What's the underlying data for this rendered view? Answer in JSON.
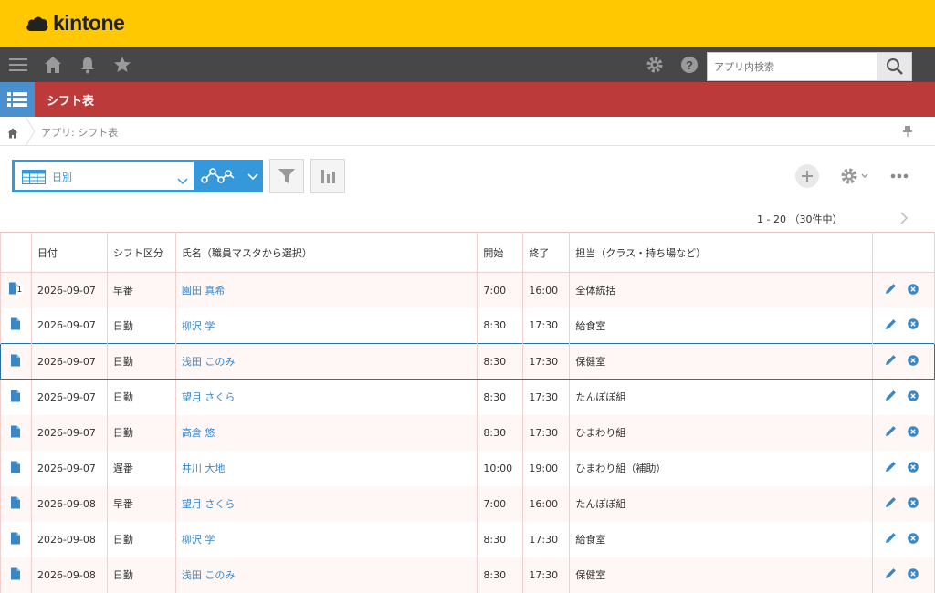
{
  "brand": {
    "name": "kintone"
  },
  "search": {
    "placeholder": "アプリ内検索"
  },
  "app": {
    "title": "シフト表"
  },
  "breadcrumb": {
    "text": "アプリ: シフト表"
  },
  "view": {
    "selected": "日別"
  },
  "pager": {
    "text": "1 - 20 （30件中）"
  },
  "columns": [
    "日付",
    "シフト区分",
    "氏名（職員マスタから選択）",
    "開始",
    "終了",
    "担当（クラス・持ち場など）"
  ],
  "rows": [
    {
      "date": "2026-09-07",
      "shift": "早番",
      "name": "園田 真希",
      "start": "7:00",
      "end": "16:00",
      "duty": "全体統括",
      "badge": "1"
    },
    {
      "date": "2026-09-07",
      "shift": "日勤",
      "name": "柳沢 学",
      "start": "8:30",
      "end": "17:30",
      "duty": "給食室"
    },
    {
      "date": "2026-09-07",
      "shift": "日勤",
      "name": "浅田 このみ",
      "start": "8:30",
      "end": "17:30",
      "duty": "保健室",
      "selected": true
    },
    {
      "date": "2026-09-07",
      "shift": "日勤",
      "name": "望月 さくら",
      "start": "8:30",
      "end": "17:30",
      "duty": "たんぽぽ組"
    },
    {
      "date": "2026-09-07",
      "shift": "日勤",
      "name": "高倉 悠",
      "start": "8:30",
      "end": "17:30",
      "duty": "ひまわり組"
    },
    {
      "date": "2026-09-07",
      "shift": "遅番",
      "name": "井川 大地",
      "start": "10:00",
      "end": "19:00",
      "duty": "ひまわり組（補助）"
    },
    {
      "date": "2026-09-08",
      "shift": "早番",
      "name": "望月 さくら",
      "start": "7:00",
      "end": "16:00",
      "duty": "たんぽぽ組"
    },
    {
      "date": "2026-09-08",
      "shift": "日勤",
      "name": "柳沢 学",
      "start": "8:30",
      "end": "17:30",
      "duty": "給食室"
    },
    {
      "date": "2026-09-08",
      "shift": "日勤",
      "name": "浅田 このみ",
      "start": "8:30",
      "end": "17:30",
      "duty": "保健室"
    }
  ],
  "colors": {
    "brand": "#ffc800",
    "nav": "#474747",
    "appbar": "#bc3a3a",
    "accent": "#3498db",
    "link": "#3a87c8"
  }
}
